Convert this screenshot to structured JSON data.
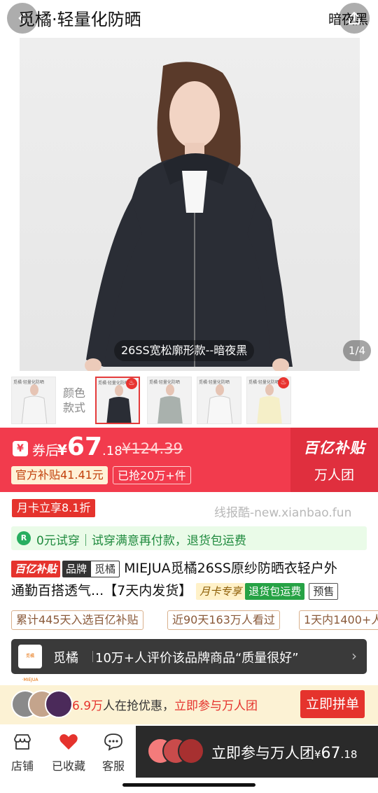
{
  "header": {
    "title": "觅橘·轻量化防晒",
    "right_text": "暗夜黑"
  },
  "hero": {
    "caption": "26SS宽松廓形款--暗夜黑",
    "counter": "1/4"
  },
  "variants": {
    "label_line1": "颜色",
    "label_line2": "款式",
    "thumb_tag": "觅橘·轻量化防晒"
  },
  "price": {
    "after_label": "券后",
    "currency": "¥",
    "integer": "67",
    "decimal": ".18",
    "original": "¥124.39",
    "subsidy": "官方补贴41.41元",
    "sold": "已抢20万+件",
    "badge": "百亿补贴",
    "group_label": "万人团"
  },
  "card_promo": "月卡立享8.1折",
  "watermark": "线报酷-new.xianbao.fun",
  "trial": {
    "icon": "R",
    "text": "0元试穿｜试穿满意再付款，退货包运费"
  },
  "title": {
    "tag_bybt": "百亿补贴",
    "tag_brand": "品牌",
    "tag_brand_name": "觅橘",
    "line1_text": "MIEJUA觅橘26SS原纱防晒衣轻户外",
    "line2_text": "通勤百搭透气...【7天内发货】",
    "tag_card": "月卡专享",
    "tag_return": "退货包运费",
    "tag_presale": "预售"
  },
  "stats": [
    "累计445天入选百亿补贴",
    "近90天163万人看过",
    "1天内1400+人"
  ],
  "brand": {
    "logo_text": "觅橘·MIEJUA",
    "name": "觅橘",
    "text": "10万+人评价该品牌商品“质量很好”",
    "arrow": "›"
  },
  "group": {
    "count": "6.9万",
    "text_mid": "人在抢优惠，",
    "link": "立即参与万人团",
    "button": "立即拼单"
  },
  "bottom_nav": [
    {
      "label": "店铺",
      "icon": "store-icon"
    },
    {
      "label": "已收藏",
      "icon": "heart-icon"
    },
    {
      "label": "客服",
      "icon": "chat-icon"
    }
  ],
  "cta": {
    "text": "立即参与万人团",
    "currency": "¥",
    "integer": "67",
    "decimal": ".18"
  },
  "colors": {
    "accent": "#f23b4d",
    "deep_red": "#e5332d",
    "dark": "#2a2a2a",
    "green": "#27ae60"
  }
}
